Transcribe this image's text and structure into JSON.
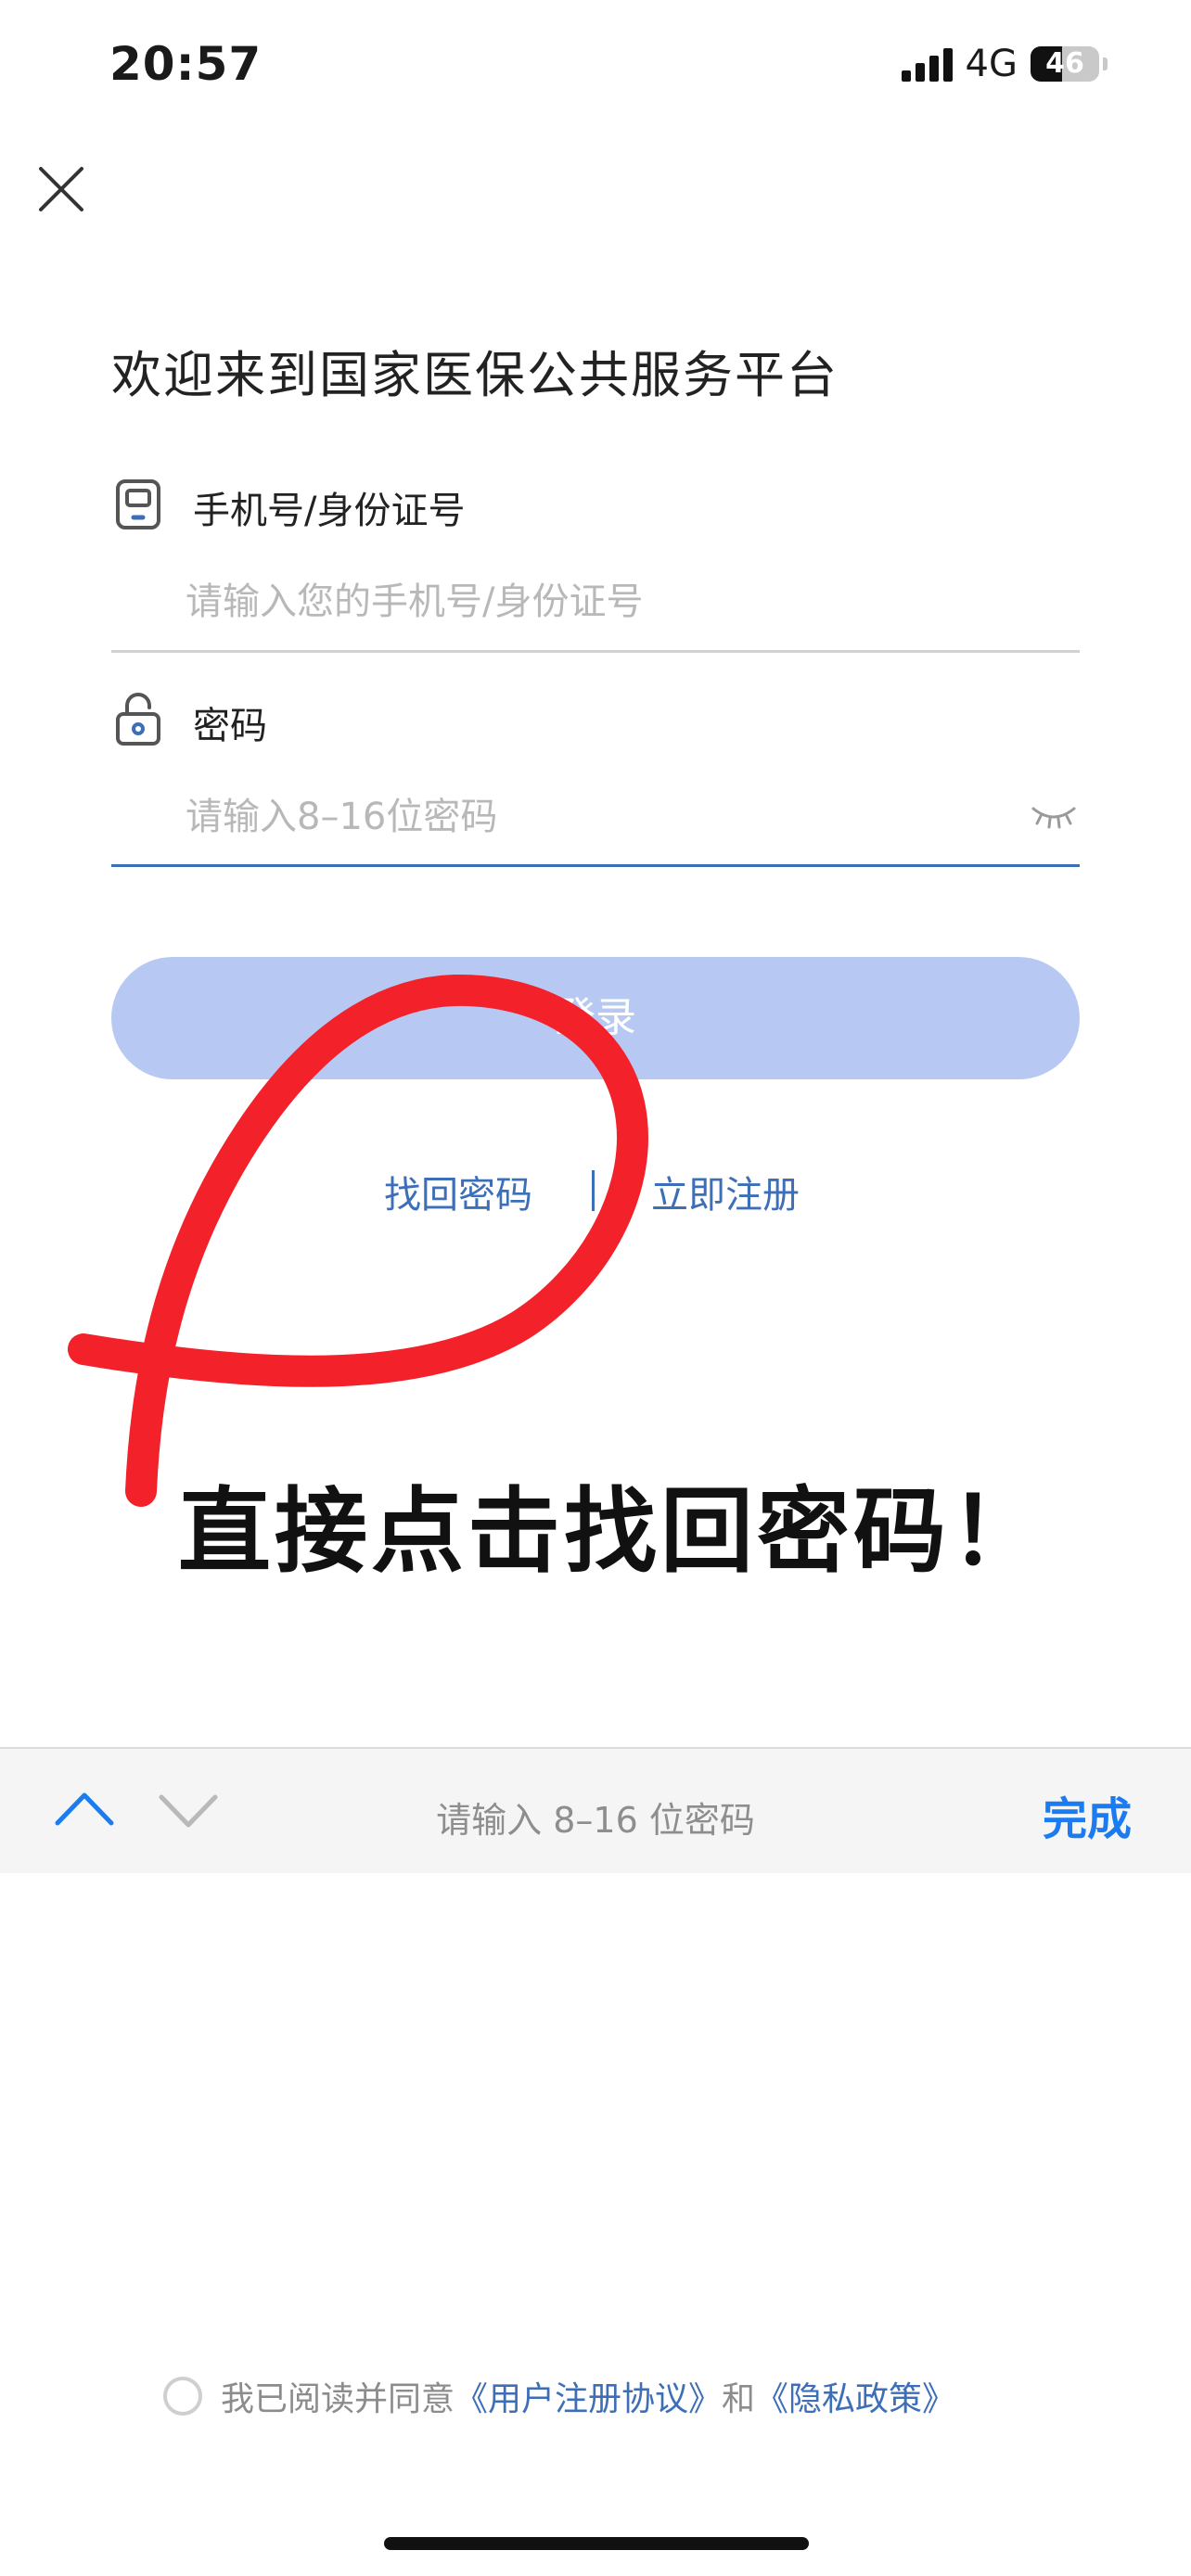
{
  "status_bar": {
    "time": "20:57",
    "network": "4G",
    "battery": "46",
    "battery_level": 0.46
  },
  "header": {
    "close_icon": "close-icon"
  },
  "title": "欢迎来到国家医保公共服务平台",
  "account_field": {
    "label": "手机号/身份证号",
    "placeholder": "请输入您的手机号/身份证号",
    "value": "",
    "icon": "phone-icon"
  },
  "password_field": {
    "label": "密码",
    "placeholder": "请输入8–16位密码",
    "value": "",
    "icon": "lock-icon",
    "toggle_icon": "eye-closed-icon"
  },
  "login_button": {
    "label": "登录"
  },
  "links": {
    "forgot_password": "找回密码",
    "separator": "|",
    "register": "立即注册"
  },
  "annotation": {
    "text": "直接点击找回密码！",
    "color": "#f2212a"
  },
  "keyboard_toolbar": {
    "hint": "请输入 8–16 位密码",
    "done": "完成"
  },
  "agreement": {
    "prefix": "我已阅读并同意",
    "user_agreement": "《用户注册协议》",
    "and": "和",
    "privacy_policy": "《隐私政策》"
  },
  "colors": {
    "accent": "#3d6fb8",
    "button_disabled": "#b7c9f3",
    "done_blue": "#1a7cf0"
  }
}
